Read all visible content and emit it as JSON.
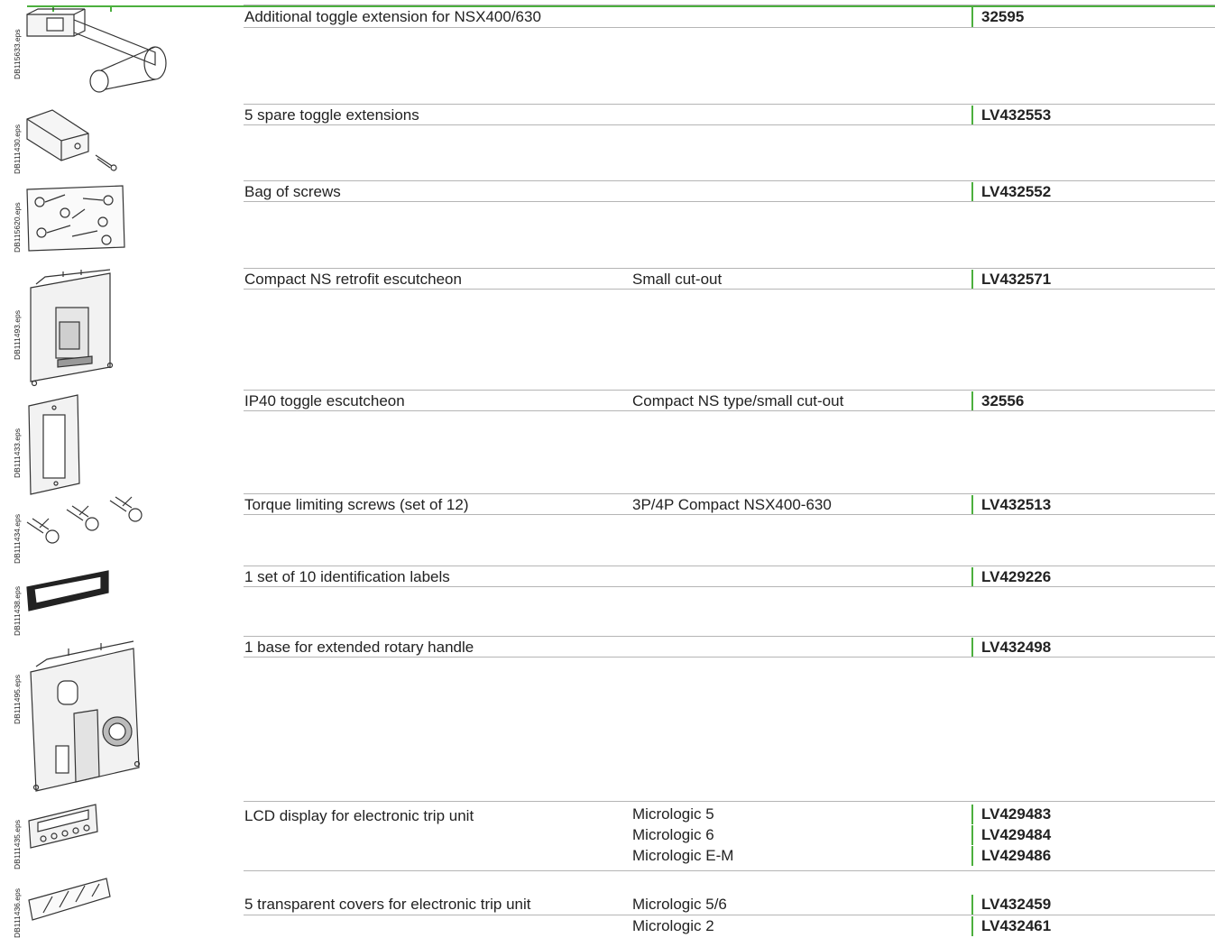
{
  "accent_color": "#4caf3e",
  "items": [
    {
      "code": "DB115633.eps",
      "description": "Additional toggle extension for NSX400/630",
      "sub": [
        ""
      ],
      "refs": [
        "32595"
      ]
    },
    {
      "code": "DB111430.eps",
      "description": "5 spare toggle extensions",
      "sub": [
        ""
      ],
      "refs": [
        "LV432553"
      ]
    },
    {
      "code": "DB115620.eps",
      "description": "Bag of screws",
      "sub": [
        ""
      ],
      "refs": [
        "LV432552"
      ]
    },
    {
      "code": "DB111493.eps",
      "description": "Compact NS retrofit escutcheon",
      "sub": [
        "Small cut-out"
      ],
      "refs": [
        "LV432571"
      ]
    },
    {
      "code": "DB111433.eps",
      "description": "IP40 toggle escutcheon",
      "sub": [
        "Compact NS type/small cut-out"
      ],
      "refs": [
        "32556"
      ]
    },
    {
      "code": "DB111434.eps",
      "description": "Torque limiting screws (set of 12)",
      "sub": [
        "3P/4P Compact NSX400-630"
      ],
      "refs": [
        "LV432513"
      ]
    },
    {
      "code": "DB111438.eps",
      "description": "1 set of 10 identification labels",
      "sub": [
        ""
      ],
      "refs": [
        "LV429226"
      ]
    },
    {
      "code": "DB111495.eps",
      "description": "1 base for extended rotary handle",
      "sub": [
        ""
      ],
      "refs": [
        "LV432498"
      ]
    },
    {
      "code": "DB111435.eps",
      "description": "LCD display for electronic trip unit",
      "sub": [
        "Micrologic 5",
        "Micrologic 6",
        "Micrologic E-M"
      ],
      "refs": [
        "LV429483",
        "LV429484",
        "LV429486"
      ]
    },
    {
      "code": "DB111436.eps",
      "description": "5 transparent covers for electronic trip unit",
      "sub": [
        "Micrologic 5/6",
        "Micrologic 2"
      ],
      "refs": [
        "LV432459",
        "LV432461"
      ]
    }
  ]
}
